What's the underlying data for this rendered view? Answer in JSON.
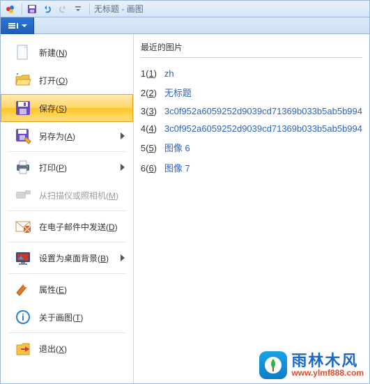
{
  "titlebar": {
    "doc_title": "无标题",
    "app_name": "画图"
  },
  "menu": [
    {
      "key": "new",
      "label": "新建",
      "accel": "N",
      "submenu": false,
      "disabled": false,
      "selected": false
    },
    {
      "key": "open",
      "label": "打开",
      "accel": "O",
      "submenu": false,
      "disabled": false,
      "selected": false
    },
    {
      "key": "save",
      "label": "保存",
      "accel": "S",
      "submenu": false,
      "disabled": false,
      "selected": true
    },
    {
      "key": "saveas",
      "label": "另存为",
      "accel": "A",
      "submenu": true,
      "disabled": false,
      "selected": false
    },
    {
      "key": "print",
      "label": "打印",
      "accel": "P",
      "submenu": true,
      "disabled": false,
      "selected": false
    },
    {
      "key": "scanner",
      "label": "从扫描仪或照相机",
      "accel": "M",
      "submenu": false,
      "disabled": true,
      "selected": false
    },
    {
      "key": "email",
      "label": "在电子邮件中发送",
      "accel": "D",
      "submenu": false,
      "disabled": false,
      "selected": false
    },
    {
      "key": "wallpaper",
      "label": "设置为桌面背景",
      "accel": "B",
      "submenu": true,
      "disabled": false,
      "selected": false
    },
    {
      "key": "props",
      "label": "属性",
      "accel": "E",
      "submenu": false,
      "disabled": false,
      "selected": false
    },
    {
      "key": "about",
      "label": "关于画图",
      "accel": "T",
      "submenu": false,
      "disabled": false,
      "selected": false
    },
    {
      "key": "exit",
      "label": "退出",
      "accel": "X",
      "submenu": false,
      "disabled": false,
      "selected": false
    }
  ],
  "panel": {
    "title": "最近的图片",
    "recent": [
      {
        "idx": 1,
        "name": "zh"
      },
      {
        "idx": 2,
        "name": "无标题"
      },
      {
        "idx": 3,
        "name": "3c0f952a6059252d9039cd71369b033b5ab5b994"
      },
      {
        "idx": 4,
        "name": "3c0f952a6059252d9039cd71369b033b5ab5b994"
      },
      {
        "idx": 5,
        "name": "图像 6"
      },
      {
        "idx": 6,
        "name": "图像 7"
      }
    ]
  },
  "watermark": {
    "text_cn": "雨林木风",
    "url": "www.ylmf888.com"
  }
}
